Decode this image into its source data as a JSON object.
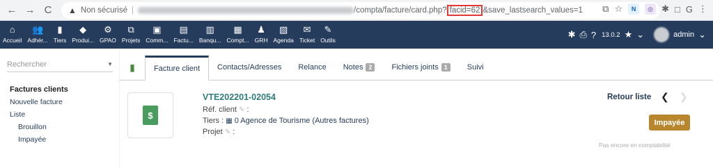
{
  "browser": {
    "back_icon": "←",
    "forward_icon": "→",
    "reload_icon": "C",
    "warning_icon": "▲",
    "not_secure": "Non sécurisé",
    "separator": "|",
    "url_path_before": "/compta/facture/card.php?",
    "url_highlight": "facid=62",
    "url_path_after": "&save_lastsearch_values=1",
    "right_icons": [
      "⧉",
      "☆",
      "N",
      "◎",
      "✱",
      "□",
      "G",
      "⋮"
    ]
  },
  "topmenu": {
    "items": [
      {
        "icon": "⌂",
        "label": "Accueil"
      },
      {
        "icon": "👥",
        "label": "Adhér..."
      },
      {
        "icon": "▮",
        "label": "Tiers"
      },
      {
        "icon": "◆",
        "label": "Produi..."
      },
      {
        "icon": "⚙",
        "label": "GPAO"
      },
      {
        "icon": "⧉",
        "label": "Projets"
      },
      {
        "icon": "▣",
        "label": "Comm..."
      },
      {
        "icon": "▤",
        "label": "Factu..."
      },
      {
        "icon": "▥",
        "label": "Banqu..."
      },
      {
        "icon": "▦",
        "label": "Compt..."
      },
      {
        "icon": "♟",
        "label": "GRH"
      },
      {
        "icon": "▧",
        "label": "Agenda"
      },
      {
        "icon": "✉",
        "label": "Ticket"
      },
      {
        "icon": "✎",
        "label": "Outils"
      }
    ],
    "bug_icon": "✱",
    "print_icon": "⎙",
    "help_icon": "?",
    "version": "13.0.2",
    "bookmark_icon": "★",
    "bookmark_caret": "⌄",
    "user": "admin",
    "user_caret": "⌄"
  },
  "sidebar": {
    "search_placeholder": "Rechercher",
    "search_caret": "▼",
    "section_title": "Factures clients",
    "links": [
      "Nouvelle facture",
      "Liste"
    ],
    "sub_links": [
      "Brouillon",
      "Impayée"
    ]
  },
  "tabs": {
    "icon": "▮",
    "items": [
      {
        "label": "Facture client"
      },
      {
        "label": "Contacts/Adresses"
      },
      {
        "label": "Relance"
      },
      {
        "label": "Notes",
        "badge": "2"
      },
      {
        "label": "Fichiers joints",
        "badge": "1"
      },
      {
        "label": "Suivi"
      }
    ]
  },
  "card": {
    "doc_icon": "$",
    "ref": "VTE202201-02054",
    "ref_client_label": "Réf. client",
    "ref_client_suffix": " :",
    "tiers_label": "Tiers : ",
    "tiers_icon": "▦",
    "tiers_name": "0 Agence de Tourisme (Autres factures)",
    "project_label": "Projet",
    "project_suffix": " :",
    "pencil_icon": "✎",
    "back_list": "Retour liste",
    "prev_icon": "❮",
    "next_icon": "❯",
    "status": "Impayée",
    "accounting_note": "Pas encore en comptabilité"
  }
}
